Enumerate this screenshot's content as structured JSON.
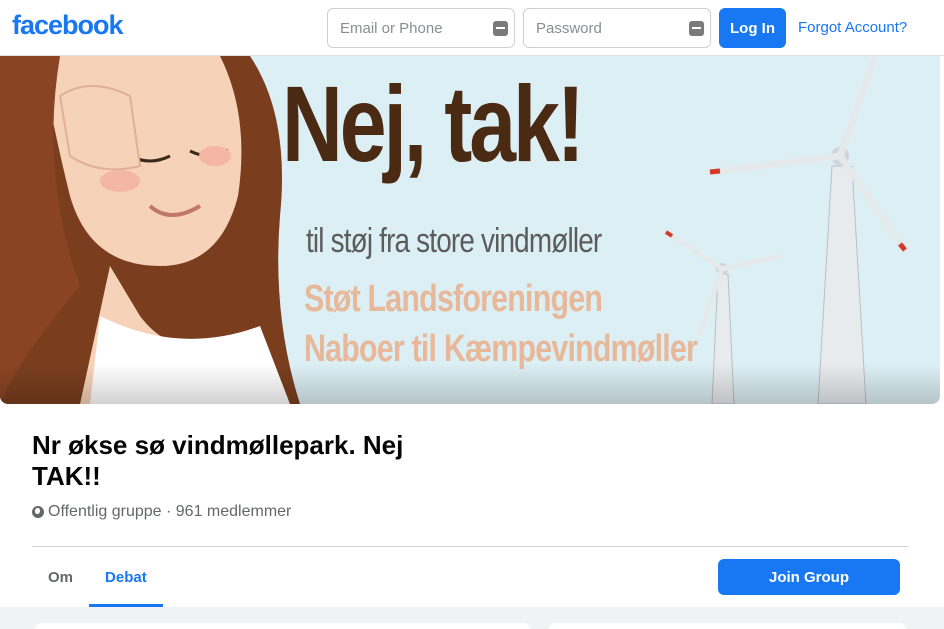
{
  "header": {
    "logo": "facebook",
    "email_placeholder": "Email or Phone",
    "password_placeholder": "Password",
    "login_label": "Log In",
    "forgot_label": "Forgot Account?"
  },
  "cover": {
    "headline": "Nej, tak!",
    "line1": "til støj fra store vindmøller",
    "line2": "Støt Landsforeningen",
    "line3": "Naboer til Kæmpevindmøller"
  },
  "group": {
    "title": "Nr økse sø vindmøllepark. Nej TAK!!",
    "meta": "Offentlig gruppe · 961 medlemmer"
  },
  "tabs": [
    {
      "label": "Om"
    },
    {
      "label": "Debat"
    }
  ],
  "join_label": "Join Group",
  "colors": {
    "brand": "#1877f2",
    "headline": "#4a2a12",
    "accent_text": "#e8b89a"
  }
}
